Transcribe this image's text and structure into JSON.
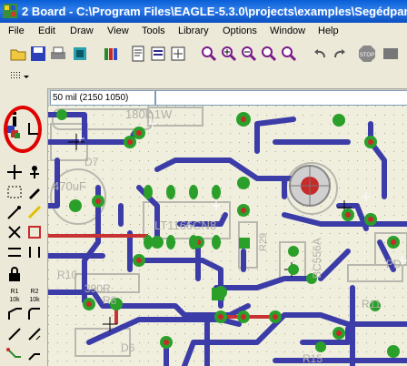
{
  "window": {
    "title": "2 Board - C:\\Program Files\\EAGLE-5.3.0\\projects\\examples\\Segédpan"
  },
  "menu": [
    "File",
    "Edit",
    "Draw",
    "View",
    "Tools",
    "Library",
    "Options",
    "Window",
    "Help"
  ],
  "coords": {
    "display": "50 mil (2150 1050)"
  },
  "command": {
    "value": ""
  },
  "board_labels": [
    "180k 1W",
    "LT1166CN8",
    "470uF",
    "BC556A",
    "R29",
    "R11",
    "R15",
    "R10",
    "R8",
    "D6",
    "D7",
    "390R",
    "PD"
  ]
}
